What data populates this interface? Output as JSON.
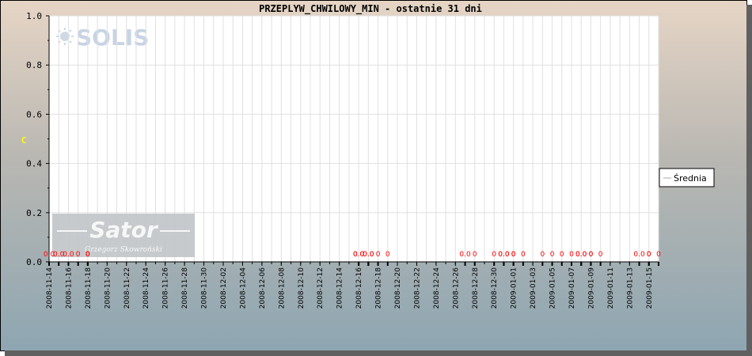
{
  "chart_data": {
    "type": "line",
    "title": "PRZEPLYW_CHWILOWY_MIN - ostatnie 31 dni",
    "ylabel": "C",
    "xlabel": "",
    "ylim": [
      0,
      1.0
    ],
    "yticks": [
      "0.0",
      "0.2",
      "0.4",
      "0.6",
      "0.8",
      "1.0"
    ],
    "xlim": [
      "2008-11-14",
      "2009-01-16"
    ],
    "xticks": [
      "2008-11-14",
      "2008-11-16",
      "2008-11-18",
      "2008-11-20",
      "2008-11-22",
      "2008-11-24",
      "2008-11-26",
      "2008-11-28",
      "2008-11-30",
      "2008-12-02",
      "2008-12-04",
      "2008-12-06",
      "2008-12-08",
      "2008-12-10",
      "2008-12-12",
      "2008-12-14",
      "2008-12-16",
      "2008-12-18",
      "2008-12-20",
      "2008-12-22",
      "2008-12-24",
      "2008-12-26",
      "2008-12-28",
      "2008-12-30",
      "2009-01-01",
      "2009-01-03",
      "2009-01-05",
      "2009-01-07",
      "2009-01-09",
      "2009-01-11",
      "2009-01-13",
      "2009-01-15"
    ],
    "grid": true,
    "legend_position": "right",
    "series": [
      {
        "name": "Średnia",
        "color": "#ff0000",
        "x": [
          "2008-11-14",
          "2008-11-15",
          "2008-11-16",
          "2008-11-17",
          "2008-11-18",
          "2008-11-18",
          "2008-11-18",
          "2008-12-16",
          "2008-12-16",
          "2008-12-17",
          "2008-12-17",
          "2008-12-18",
          "2008-12-19",
          "2008-12-27",
          "2008-12-28",
          "2008-12-30",
          "2008-12-31",
          "2008-12-31",
          "2009-01-01",
          "2009-01-01",
          "2009-01-02",
          "2009-01-04",
          "2009-01-05",
          "2009-01-06",
          "2009-01-07",
          "2009-01-08",
          "2009-01-08",
          "2009-01-09",
          "2009-01-09",
          "2009-01-10",
          "2009-01-14",
          "2009-01-15",
          "2009-01-15",
          "2009-01-16"
        ],
        "values": [
          0,
          0,
          0,
          0,
          0,
          0,
          0,
          0,
          0,
          0,
          0,
          0,
          0,
          0,
          0,
          0,
          0,
          0,
          0,
          0,
          0,
          0,
          0,
          0,
          0,
          0,
          0,
          0,
          0,
          0,
          0,
          0,
          0,
          0
        ],
        "labels": [
          "0.0",
          "0.0",
          "0.0",
          "0",
          "0",
          "0",
          "0",
          "0.0",
          "0.0",
          "0.0",
          "0.0",
          "0",
          "0",
          "0.0",
          "0",
          "0",
          "0.0",
          "0.0",
          "0",
          "0",
          "0",
          "0",
          "0",
          "0",
          "0",
          "0.0",
          "0.0",
          "0",
          "0",
          "0",
          "0.0",
          "0",
          "0",
          "0"
        ]
      }
    ],
    "legend_line_color": "#aaaaaa"
  },
  "watermarks": {
    "top_logo": "SOLIS",
    "bottom_logo": "Sator",
    "bottom_caption": "Grzegorz Skowroński"
  },
  "colors": {
    "plot_background": "#ffffff",
    "grid": "#e0e0e0",
    "data_label": "#ff0000",
    "ylabel": "#ffff00"
  }
}
